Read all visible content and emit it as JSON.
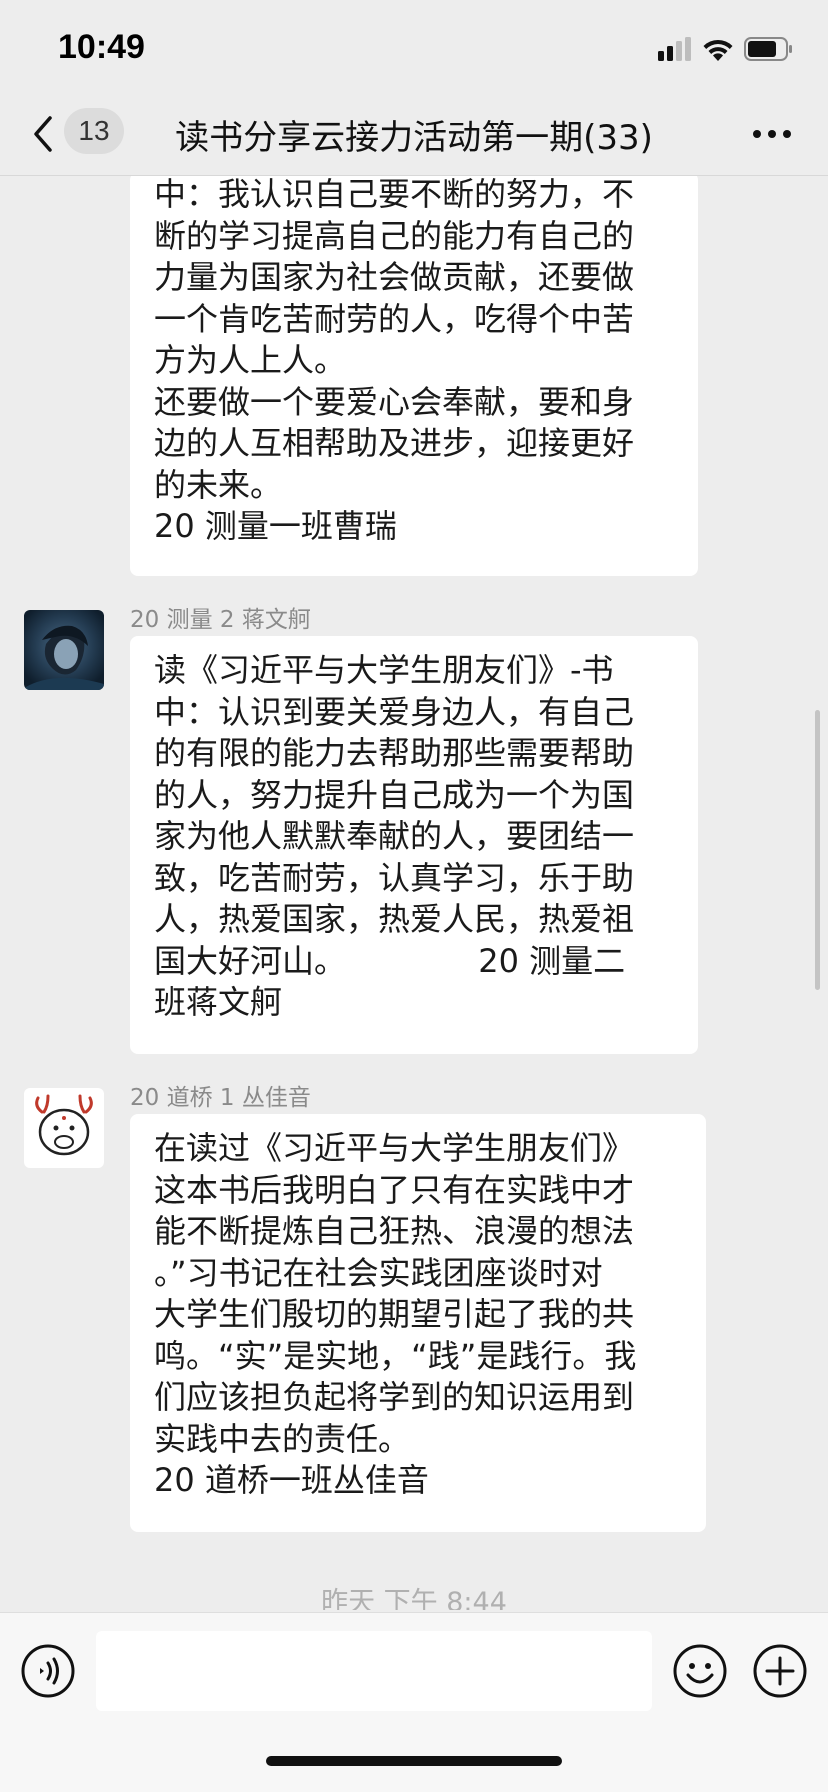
{
  "status_bar": {
    "time": "10:49"
  },
  "header": {
    "unread_count": "13",
    "title": "读书分享云接力活动第一期(33)"
  },
  "messages": [
    {
      "text": "中：我认识自己要不断的努力，不\n断的学习提高自己的能力有自己的\n力量为国家为社会做贡献，还要做\n一个肯吃苦耐劳的人，吃得个中苦\n方为人上人。\n还要做一个要爱心会奉献，要和身\n边的人互相帮助及进步，迎接更好\n的未来。\n20 测量一班曹瑞"
    },
    {
      "sender": "20 测量 2 蒋文舸",
      "text": "读《习近平与大学生朋友们》-书\n中：认识到要关爱身边人，有自己\n的有限的能力去帮助那些需要帮助\n的人，努力提升自己成为一个为国\n家为他人默默奉献的人，要团结一\n致，吃苦耐劳，认真学习，乐于助\n人，热爱国家，热爱人民，热爱祖\n国大好河山。             20 测量二\n班蒋文舸"
    },
    {
      "sender": "20 道桥 1 丛佳音",
      "text": "在读过《习近平与大学生朋友们》\n这本书后我明白了只有在实践中才\n能不断提炼自己狂热、浪漫的想法\n。”习书记在社会实践团座谈时对\n大学生们殷切的期望引起了我的共\n鸣。“实”是实地，“践”是践行。我\n们应该担负起将学到的知识运用到\n实践中去的责任。\n20 道桥一班丛佳音"
    }
  ],
  "timestamp": "昨天 下午 8:44",
  "input": {
    "placeholder": ""
  },
  "colors": {
    "chat_background": "#ededed",
    "bubble": "#ffffff",
    "input_bar": "#f7f7f7"
  }
}
